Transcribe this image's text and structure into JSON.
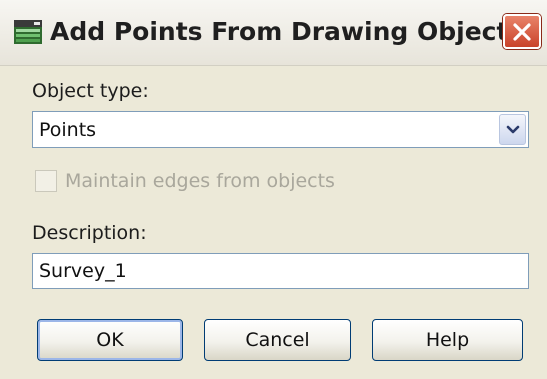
{
  "window": {
    "title": "Add Points From Drawing Objects",
    "icon": "surface-icon",
    "close_icon": "close-icon"
  },
  "object_type": {
    "label": "Object type:",
    "selected": "Points"
  },
  "maintain_edges": {
    "label": "Maintain edges from objects",
    "checked": false,
    "enabled": false
  },
  "description": {
    "label": "Description:",
    "value": "Survey_1"
  },
  "buttons": {
    "ok": "OK",
    "cancel": "Cancel",
    "help": "Help"
  },
  "colors": {
    "dialog_bg": "#ece9d8",
    "close_red": "#c9432a",
    "field_border": "#7f9db9",
    "disabled_text": "#a9a79c"
  }
}
